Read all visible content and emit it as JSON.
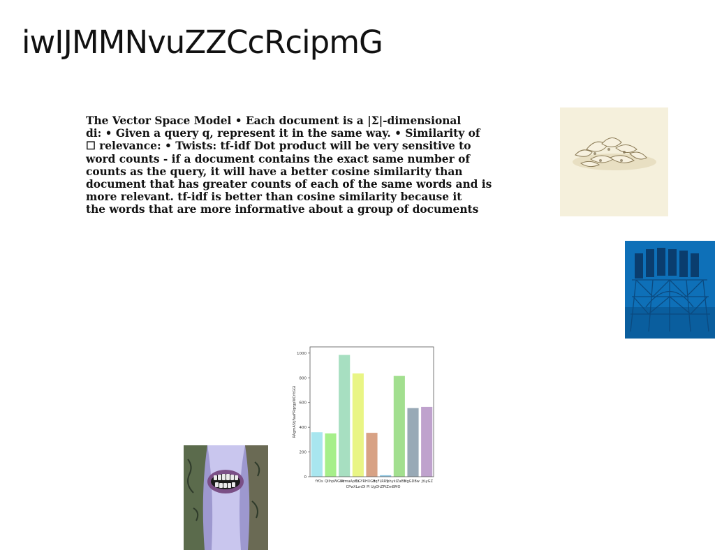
{
  "slide": {
    "title": "iwIJMMNvuZZCcRcipmG",
    "body_lines": [
      "The Vector Space Model • Each document is a |Σ|-dimensional",
      "di: • Given a query q, represent it in the same way. • Similarity of",
      "☐ relevance: • Twists:  tf-idf Dot product will be very sensitive to",
      "word counts - if a document contains the exact same number of",
      "counts as the query, it will have a better cosine similarity than",
      "document that has greater counts of each of the same words and is",
      "more relevant. tf-idf is better than cosine similarity because it",
      "the words that are more informative about a group of documents"
    ]
  },
  "images": {
    "shells": "shells photo",
    "sign": "blue sign photo",
    "face": "face with grill photo"
  },
  "chart_data": {
    "type": "bar",
    "categories": [
      "fYOs",
      "QIIhpWGKd",
      "ArmaApEo",
      "CGYRHXGB",
      "CPwXLznDI Pl",
      "BFLRRSUgOhZPtZmBMO",
      "phykIZaBS",
      "HgGDBw",
      "JtLyGZ"
    ],
    "tick_labels_row1": [
      "fYOs",
      "QIIhpWGKd",
      "ArmaApEo",
      "CGYRHXGB",
      "zqFLRRS",
      "phykIZaBS",
      "HgGDBw",
      "JtLyGZ"
    ],
    "tick_labels_row2": "CPwXLznDI Pl UgOhZPtZmBMO",
    "values": [
      360,
      350,
      985,
      835,
      355,
      12,
      815,
      555,
      565
    ],
    "colors": [
      "#a8e6ef",
      "#a6ef8a",
      "#a7dfc1",
      "#e9f585",
      "#d8a285",
      "#8cc8e4",
      "#a2df8f",
      "#98a9b6",
      "#bfa2cd"
    ],
    "ylabel": "RAgmAStjFaaFRqzgpWCrltGGl",
    "ylim": [
      0,
      1050
    ],
    "yticks": [
      0,
      200,
      400,
      600,
      800,
      1000
    ],
    "grid": false
  }
}
